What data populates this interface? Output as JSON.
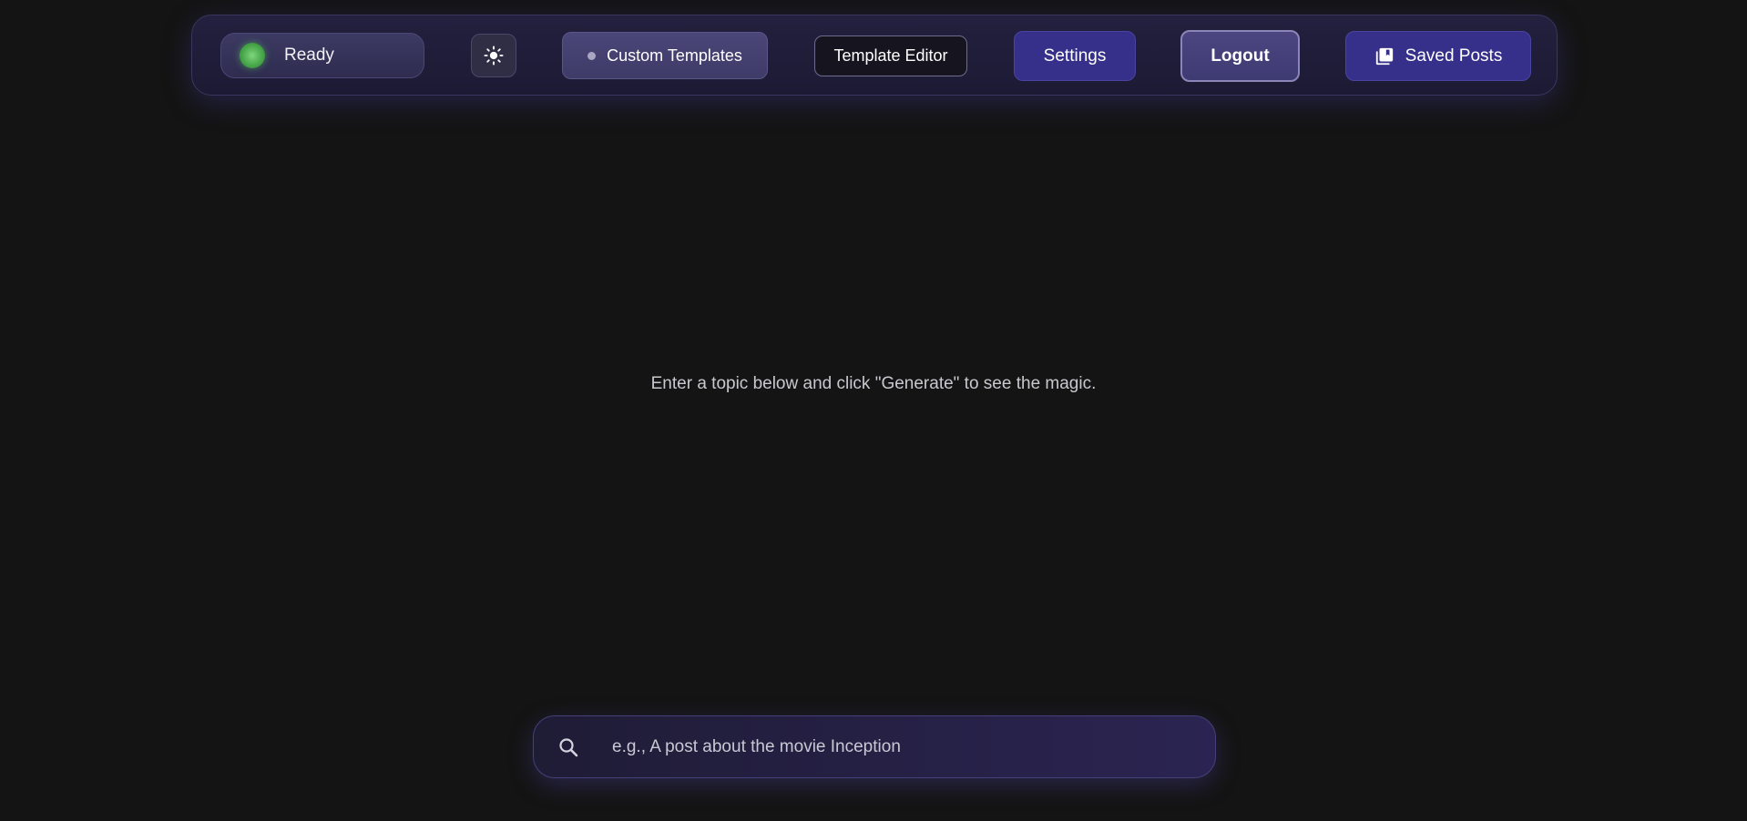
{
  "topbar": {
    "status": {
      "label": "Ready",
      "color": "#5cb85c"
    },
    "theme_toggle": {
      "icon": "sun-icon"
    },
    "custom_templates": {
      "label": "Custom Templates"
    },
    "template_editor": {
      "label": "Template Editor"
    },
    "settings": {
      "label": "Settings"
    },
    "logout": {
      "label": "Logout"
    },
    "saved_posts": {
      "label": "Saved Posts",
      "icon": "library-icon"
    }
  },
  "main": {
    "hint": "Enter a topic below and click \"Generate\" to see the magic."
  },
  "search": {
    "icon": "search-icon",
    "placeholder": "e.g., A post about the movie Inception",
    "value": ""
  },
  "colors": {
    "background": "#141414",
    "accent": "#36308a",
    "status_green": "#5cb85c"
  }
}
